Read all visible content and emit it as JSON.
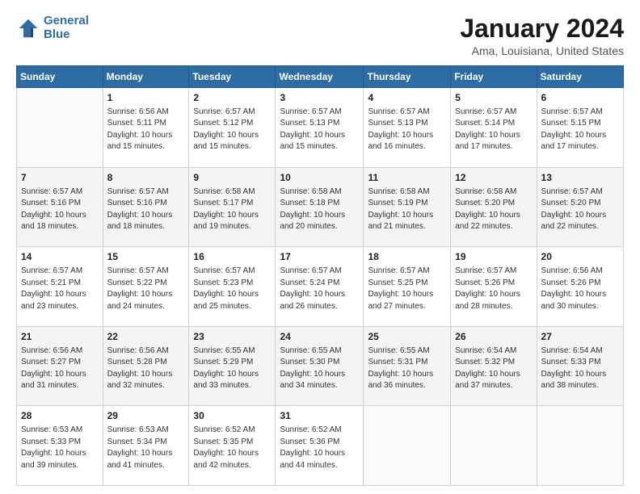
{
  "logo": {
    "line1": "General",
    "line2": "Blue"
  },
  "header": {
    "title": "January 2024",
    "subtitle": "Ama, Louisiana, United States"
  },
  "weekdays": [
    "Sunday",
    "Monday",
    "Tuesday",
    "Wednesday",
    "Thursday",
    "Friday",
    "Saturday"
  ],
  "weeks": [
    [
      {
        "day": "",
        "info": ""
      },
      {
        "day": "1",
        "info": "Sunrise: 6:56 AM\nSunset: 5:11 PM\nDaylight: 10 hours\nand 15 minutes."
      },
      {
        "day": "2",
        "info": "Sunrise: 6:57 AM\nSunset: 5:12 PM\nDaylight: 10 hours\nand 15 minutes."
      },
      {
        "day": "3",
        "info": "Sunrise: 6:57 AM\nSunset: 5:13 PM\nDaylight: 10 hours\nand 15 minutes."
      },
      {
        "day": "4",
        "info": "Sunrise: 6:57 AM\nSunset: 5:13 PM\nDaylight: 10 hours\nand 16 minutes."
      },
      {
        "day": "5",
        "info": "Sunrise: 6:57 AM\nSunset: 5:14 PM\nDaylight: 10 hours\nand 17 minutes."
      },
      {
        "day": "6",
        "info": "Sunrise: 6:57 AM\nSunset: 5:15 PM\nDaylight: 10 hours\nand 17 minutes."
      }
    ],
    [
      {
        "day": "7",
        "info": "Sunrise: 6:57 AM\nSunset: 5:16 PM\nDaylight: 10 hours\nand 18 minutes."
      },
      {
        "day": "8",
        "info": "Sunrise: 6:57 AM\nSunset: 5:16 PM\nDaylight: 10 hours\nand 18 minutes."
      },
      {
        "day": "9",
        "info": "Sunrise: 6:58 AM\nSunset: 5:17 PM\nDaylight: 10 hours\nand 19 minutes."
      },
      {
        "day": "10",
        "info": "Sunrise: 6:58 AM\nSunset: 5:18 PM\nDaylight: 10 hours\nand 20 minutes."
      },
      {
        "day": "11",
        "info": "Sunrise: 6:58 AM\nSunset: 5:19 PM\nDaylight: 10 hours\nand 21 minutes."
      },
      {
        "day": "12",
        "info": "Sunrise: 6:58 AM\nSunset: 5:20 PM\nDaylight: 10 hours\nand 22 minutes."
      },
      {
        "day": "13",
        "info": "Sunrise: 6:57 AM\nSunset: 5:20 PM\nDaylight: 10 hours\nand 22 minutes."
      }
    ],
    [
      {
        "day": "14",
        "info": "Sunrise: 6:57 AM\nSunset: 5:21 PM\nDaylight: 10 hours\nand 23 minutes."
      },
      {
        "day": "15",
        "info": "Sunrise: 6:57 AM\nSunset: 5:22 PM\nDaylight: 10 hours\nand 24 minutes."
      },
      {
        "day": "16",
        "info": "Sunrise: 6:57 AM\nSunset: 5:23 PM\nDaylight: 10 hours\nand 25 minutes."
      },
      {
        "day": "17",
        "info": "Sunrise: 6:57 AM\nSunset: 5:24 PM\nDaylight: 10 hours\nand 26 minutes."
      },
      {
        "day": "18",
        "info": "Sunrise: 6:57 AM\nSunset: 5:25 PM\nDaylight: 10 hours\nand 27 minutes."
      },
      {
        "day": "19",
        "info": "Sunrise: 6:57 AM\nSunset: 5:26 PM\nDaylight: 10 hours\nand 28 minutes."
      },
      {
        "day": "20",
        "info": "Sunrise: 6:56 AM\nSunset: 5:26 PM\nDaylight: 10 hours\nand 30 minutes."
      }
    ],
    [
      {
        "day": "21",
        "info": "Sunrise: 6:56 AM\nSunset: 5:27 PM\nDaylight: 10 hours\nand 31 minutes."
      },
      {
        "day": "22",
        "info": "Sunrise: 6:56 AM\nSunset: 5:28 PM\nDaylight: 10 hours\nand 32 minutes."
      },
      {
        "day": "23",
        "info": "Sunrise: 6:55 AM\nSunset: 5:29 PM\nDaylight: 10 hours\nand 33 minutes."
      },
      {
        "day": "24",
        "info": "Sunrise: 6:55 AM\nSunset: 5:30 PM\nDaylight: 10 hours\nand 34 minutes."
      },
      {
        "day": "25",
        "info": "Sunrise: 6:55 AM\nSunset: 5:31 PM\nDaylight: 10 hours\nand 36 minutes."
      },
      {
        "day": "26",
        "info": "Sunrise: 6:54 AM\nSunset: 5:32 PM\nDaylight: 10 hours\nand 37 minutes."
      },
      {
        "day": "27",
        "info": "Sunrise: 6:54 AM\nSunset: 5:33 PM\nDaylight: 10 hours\nand 38 minutes."
      }
    ],
    [
      {
        "day": "28",
        "info": "Sunrise: 6:53 AM\nSunset: 5:33 PM\nDaylight: 10 hours\nand 39 minutes."
      },
      {
        "day": "29",
        "info": "Sunrise: 6:53 AM\nSunset: 5:34 PM\nDaylight: 10 hours\nand 41 minutes."
      },
      {
        "day": "30",
        "info": "Sunrise: 6:52 AM\nSunset: 5:35 PM\nDaylight: 10 hours\nand 42 minutes."
      },
      {
        "day": "31",
        "info": "Sunrise: 6:52 AM\nSunset: 5:36 PM\nDaylight: 10 hours\nand 44 minutes."
      },
      {
        "day": "",
        "info": ""
      },
      {
        "day": "",
        "info": ""
      },
      {
        "day": "",
        "info": ""
      }
    ]
  ]
}
